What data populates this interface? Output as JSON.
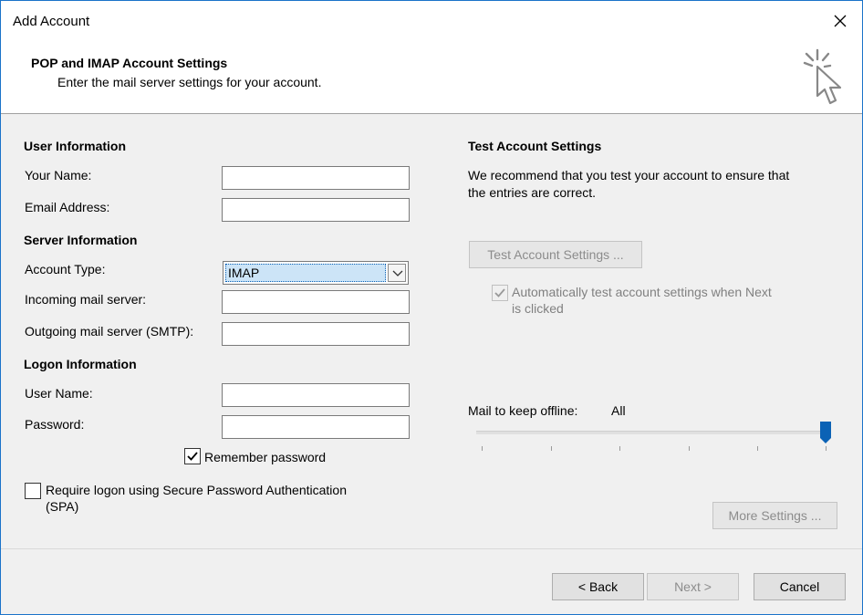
{
  "window": {
    "title": "Add Account",
    "close_label": "×"
  },
  "header": {
    "title": "POP and IMAP Account Settings",
    "subtitle": "Enter the mail server settings for your account."
  },
  "user_info": {
    "section": "User Information",
    "name_label": "Your Name:",
    "name_value": "",
    "email_label": "Email Address:",
    "email_value": ""
  },
  "server_info": {
    "section": "Server Information",
    "account_type_label": "Account Type:",
    "account_type_value": "IMAP",
    "incoming_label": "Incoming mail server:",
    "incoming_value": "",
    "outgoing_label": "Outgoing mail server (SMTP):",
    "outgoing_value": ""
  },
  "logon_info": {
    "section": "Logon Information",
    "username_label": "User Name:",
    "username_value": "",
    "password_label": "Password:",
    "password_value": "",
    "remember_label": "Remember password",
    "remember_checked": true,
    "spa_label_line1": "Require logon using Secure Password Authentication",
    "spa_label_line2": "(SPA)",
    "spa_checked": false
  },
  "test_settings": {
    "section": "Test Account Settings",
    "desc_line1": "We recommend that you test your account to ensure that",
    "desc_line2": "the entries are correct.",
    "test_button": "Test Account Settings ...",
    "auto_test_line1": "Automatically test account settings when Next",
    "auto_test_line2": "is clicked",
    "auto_test_checked": true
  },
  "offline": {
    "label": "Mail to keep offline:",
    "value": "All",
    "slider_level": 1.0
  },
  "buttons": {
    "more_settings": "More Settings ...",
    "back": "< Back",
    "next": "Next >",
    "cancel": "Cancel"
  },
  "colors": {
    "accent": "#0b62b5",
    "selection": "#cce4f7",
    "window_bg": "#f0f0f0"
  }
}
